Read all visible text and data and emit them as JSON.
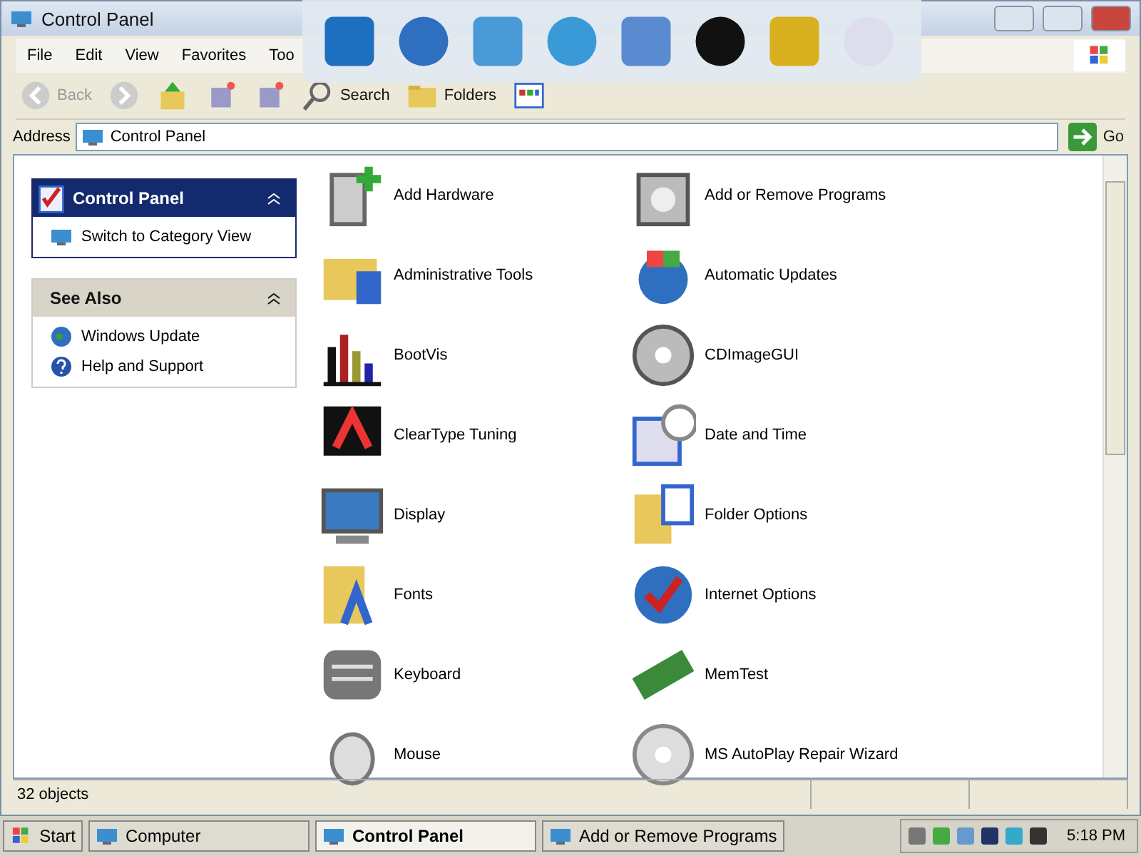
{
  "window": {
    "title": "Control Panel"
  },
  "menu": [
    "File",
    "Edit",
    "View",
    "Favorites",
    "Too"
  ],
  "toolbar": {
    "back": "Back",
    "search": "Search",
    "folders": "Folders"
  },
  "address": {
    "label": "Address",
    "value": "Control Panel",
    "go": "Go"
  },
  "sidebar": [
    {
      "title": "Control Panel",
      "primary": true,
      "items": [
        "Switch to Category View"
      ]
    },
    {
      "title": "See Also",
      "primary": false,
      "items": [
        "Windows Update",
        "Help and Support"
      ]
    }
  ],
  "items": [
    "Add Hardware",
    "Add or Remove Programs",
    "Administrative Tools",
    "Automatic Updates",
    "BootVis",
    "CDImageGUI",
    "ClearType Tuning",
    "Date and Time",
    "Display",
    "Folder Options",
    "Fonts",
    "Internet Options",
    "Keyboard",
    "MemTest",
    "Mouse",
    "MS AutoPlay Repair Wizard"
  ],
  "status_bar": "32 objects",
  "taskbar": {
    "start": "Start",
    "tasks": [
      {
        "label": "Computer",
        "selected": false
      },
      {
        "label": "Control Panel",
        "selected": true
      },
      {
        "label": "Add or Remove Programs",
        "selected": false
      }
    ],
    "clock": "5:18 PM"
  }
}
